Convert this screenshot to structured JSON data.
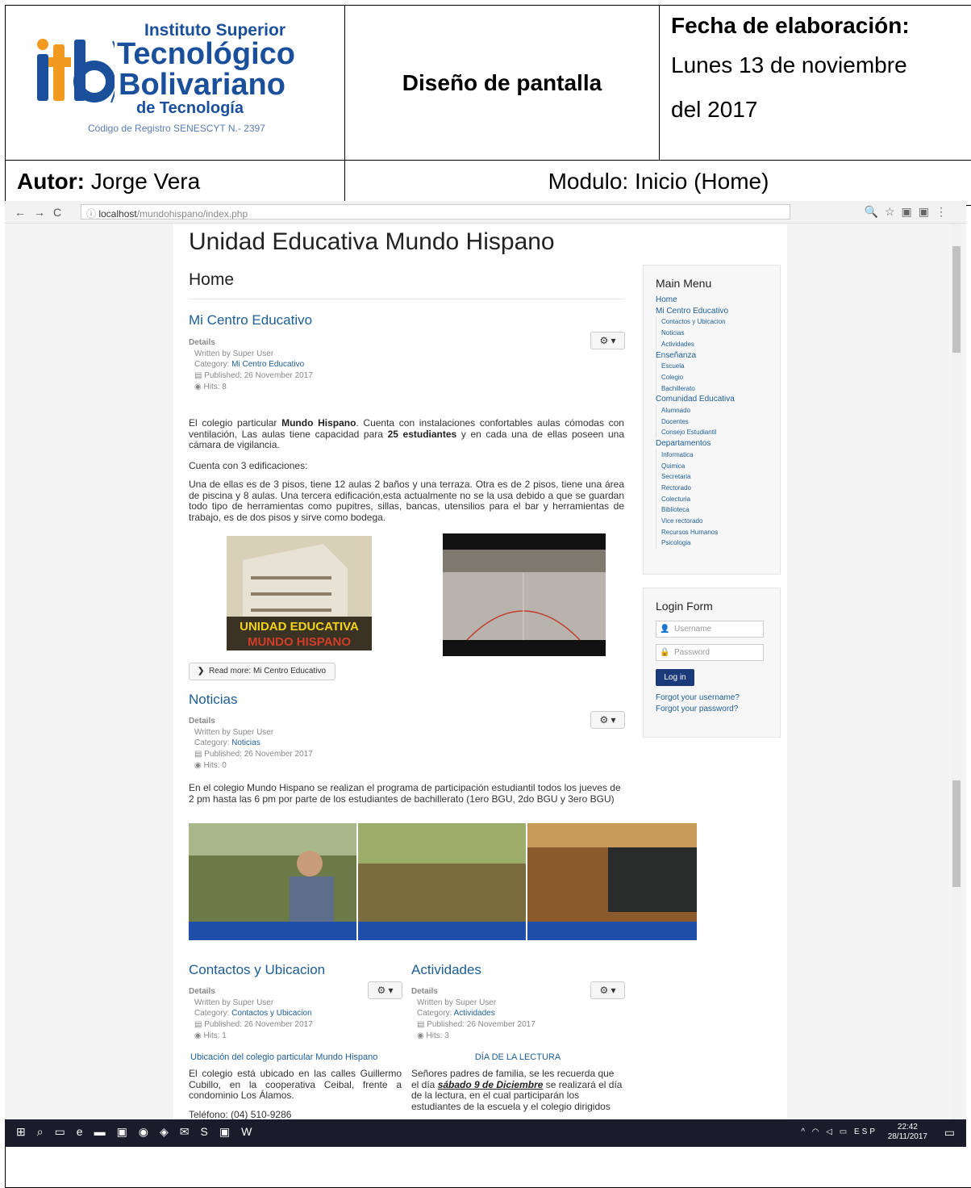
{
  "doc": {
    "logo": {
      "line1": "Instituto Superior",
      "line2": "Tecnológico",
      "line3": "Bolivariano",
      "line4": "de Tecnología",
      "reg": "Código de Registro SENESCYT N.- 2397"
    },
    "title": "Diseño de pantalla",
    "date_label": "Fecha de elaboración:",
    "date_line1": "Lunes 13 de noviembre",
    "date_line2": "del 2017",
    "author_label": "Autor:",
    "author": "Jorge Vera",
    "module": "Modulo: Inicio (Home)"
  },
  "browser": {
    "url_host": "localhost",
    "url_path": "/mundohispano/index.php"
  },
  "site": {
    "title": "Unidad Educativa Mundo Hispano",
    "page": "Home"
  },
  "articles": {
    "a1": {
      "title": "Mi Centro Educativo",
      "details": "Details",
      "written": "Written by Super User",
      "cat_label": "Category:",
      "cat": "Mi Centro Educativo",
      "published": "Published: 26 November 2017",
      "hits": "Hits: 8",
      "p1a": "El colegio particular ",
      "p1b": "Mundo Hispano",
      "p1c": ". Cuenta con instalaciones confortables aulas cómodas con ventilación, Las aulas tiene capacidad para ",
      "p1d": "25 estudiantes",
      "p1e": " y en cada una de ellas poseen una cámara de vigilancia.",
      "p2": "Cuenta con 3 edificaciones:",
      "p3": "Una de ellas es de 3 pisos, tiene 12 aulas 2 baños y una terraza. Otra es de 2 pisos, tiene una área de piscina y 8 aulas. Una tercera edificación,esta actualmente no se la usa debido a que se guardan todo tipo de herramientas como pupitres, sillas, bancas, utensilios para el bar y herramientas de trabajo, es de dos pisos y sirve como bodega.",
      "img_text1": "UNIDAD EDUCATIVA",
      "img_text2": "MUNDO HISPANO",
      "readmore": "Read more: Mi Centro Educativo"
    },
    "a2": {
      "title": "Noticias",
      "details": "Details",
      "written": "Written by Super User",
      "cat_label": "Category:",
      "cat": "Noticias",
      "published": "Published: 26 November 2017",
      "hits": "Hits: 0",
      "p1": "En el colegio Mundo Hispano se realizan el programa de participación estudiantil todos los jueves de 2 pm hasta las 6 pm por parte de los estudiantes de bachillerato (1ero BGU, 2do BGU y 3ero BGU)"
    },
    "a3": {
      "title": "Contactos y Ubicacion",
      "details": "Details",
      "written": "Written by Super User",
      "cat_label": "Category:",
      "cat": "Contactos y Ubicacion",
      "published": "Published: 26 November 2017",
      "hits": "Hits: 1",
      "sub": "Ubicación del colegio particular Mundo Hispano",
      "p1": "El colegio está ubicado en las calles Guillermo Cubillo, en la cooperativa Ceibal, frente a condominio Los Álamos.",
      "phone": "Teléfono: (04) 510-9286"
    },
    "a4": {
      "title": "Actividades",
      "details": "Details",
      "written": "Written by Super User",
      "cat_label": "Category:",
      "cat": "Actividades",
      "published": "Published: 26 November 2017",
      "hits": "Hits: 3",
      "sub": "DÍA DE LA LECTURA",
      "p1a": "Señores padres de familia, se les recuerda que el día ",
      "p1b": "sábado 9 de Diciembre",
      "p1c": " se realizará el día de la lectura, en el cual participarán los estudiantes de la escuela y el colegio dirigidos"
    }
  },
  "menu": {
    "title": "Main Menu",
    "items": [
      {
        "l": "Home",
        "s": false
      },
      {
        "l": "Mi Centro Educativo",
        "s": false
      },
      {
        "l": "Contactos y Ubicacion",
        "s": true
      },
      {
        "l": "Noticias",
        "s": true
      },
      {
        "l": "Actividades",
        "s": true
      },
      {
        "l": "Enseñanza",
        "s": false
      },
      {
        "l": "Escuela",
        "s": true
      },
      {
        "l": "Colegio",
        "s": true
      },
      {
        "l": "Bachillerato",
        "s": true
      },
      {
        "l": "Comunidad Educativa",
        "s": false
      },
      {
        "l": "Alumnado",
        "s": true
      },
      {
        "l": "Docentes",
        "s": true
      },
      {
        "l": "Consejo Estudiantil",
        "s": true
      },
      {
        "l": "Departamentos",
        "s": false
      },
      {
        "l": "Informatica",
        "s": true
      },
      {
        "l": "Quimica",
        "s": true
      },
      {
        "l": "Secretaria",
        "s": true
      },
      {
        "l": "Rectorado",
        "s": true
      },
      {
        "l": "Colecturia",
        "s": true
      },
      {
        "l": "Biblioteca",
        "s": true
      },
      {
        "l": "Vice rectorado",
        "s": true
      },
      {
        "l": "Recursos Humanos",
        "s": true
      },
      {
        "l": "Psicologia",
        "s": true
      }
    ]
  },
  "login": {
    "title": "Login Form",
    "username": "Username",
    "password": "Password",
    "button": "Log in",
    "forgot_user": "Forgot your username?",
    "forgot_pass": "Forgot your password?"
  },
  "taskbar": {
    "lang": "ESP",
    "time": "22:42",
    "date": "28/11/2017"
  },
  "colors": {
    "link": "#1c5d96",
    "button": "#1b3a7a",
    "taskbar": "#1b1b2b"
  }
}
